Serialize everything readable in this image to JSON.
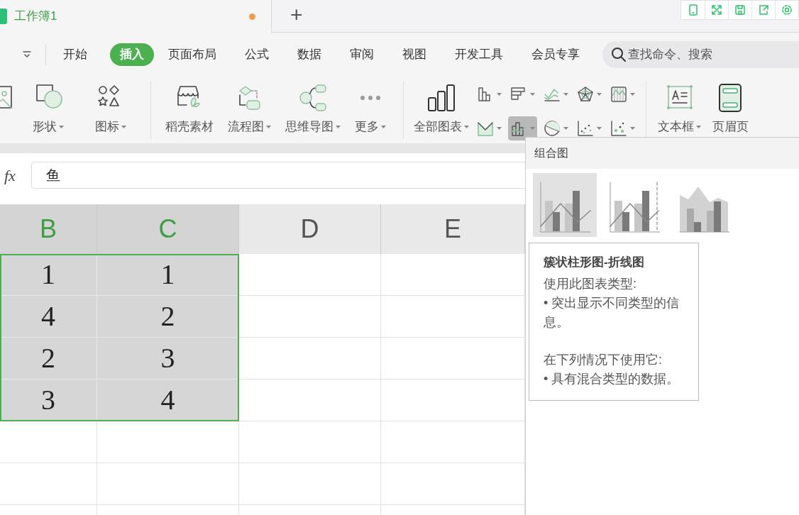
{
  "title_bar": {
    "tab": {
      "title": "工作簿1",
      "modified": true
    },
    "new_tab": "+"
  },
  "ribbon_tabs": [
    {
      "label": "开始",
      "selected": false
    },
    {
      "label": "插入",
      "selected": true
    },
    {
      "label": "页面布局",
      "selected": false
    },
    {
      "label": "公式",
      "selected": false
    },
    {
      "label": "数据",
      "selected": false
    },
    {
      "label": "审阅",
      "selected": false
    },
    {
      "label": "视图",
      "selected": false
    },
    {
      "label": "开发工具",
      "selected": false
    },
    {
      "label": "会员专享",
      "selected": false
    }
  ],
  "search": {
    "placeholder": "查找命令、搜索"
  },
  "toolbar": {
    "left_tools": [
      {
        "kind": "shape",
        "label": "形状"
      },
      {
        "kind": "icons",
        "label": "图标"
      }
    ],
    "middle_tools": [
      {
        "kind": "docer",
        "label": "稻壳素材",
        "dropdown": false
      },
      {
        "kind": "flow",
        "label": "流程图",
        "dropdown": true
      },
      {
        "kind": "mind",
        "label": "思维导图",
        "dropdown": true
      },
      {
        "kind": "more",
        "label": "更多",
        "dropdown": true
      }
    ],
    "all_charts": "全部图表",
    "chart_buttons": [
      {
        "kind": "column",
        "selected": false
      },
      {
        "kind": "bar",
        "selected": false
      },
      {
        "kind": "line",
        "selected": false
      },
      {
        "kind": "radar",
        "selected": false
      },
      {
        "kind": "stock",
        "selected": false
      },
      {
        "kind": "area",
        "selected": false
      },
      {
        "kind": "combo",
        "selected": true
      },
      {
        "kind": "pie",
        "selected": false
      },
      {
        "kind": "scatter",
        "selected": false
      },
      {
        "kind": "bubble",
        "selected": false
      }
    ],
    "right_tools": [
      {
        "kind": "textbox",
        "label": "文本框"
      },
      {
        "kind": "header",
        "label": "页眉页"
      }
    ]
  },
  "formula_bar": {
    "label": "fx",
    "value": "鱼"
  },
  "grid": {
    "columns": [
      {
        "label": "B",
        "selected": true
      },
      {
        "label": "C",
        "selected": true
      },
      {
        "label": "D",
        "selected": false
      },
      {
        "label": "E",
        "selected": false
      }
    ],
    "rows": [
      {
        "cells": [
          "1",
          "1"
        ],
        "selected": true
      },
      {
        "cells": [
          "4",
          "2"
        ],
        "selected": true
      },
      {
        "cells": [
          "2",
          "3"
        ],
        "selected": true
      },
      {
        "cells": [
          "3",
          "4"
        ],
        "selected": true
      }
    ]
  },
  "combo_menu": {
    "title": "组合图",
    "types": [
      {
        "kind": "column-line",
        "selected": true
      },
      {
        "kind": "column-line-axis",
        "selected": false
      },
      {
        "kind": "area-column",
        "selected": false
      }
    ],
    "tooltip": {
      "title": "簇状柱形图-折线图",
      "paragraphs": [
        [
          "使用此图表类型:",
          "• 突出显示不同类型的信息。"
        ],
        [
          "在下列情况下使用它:",
          "• 具有混合类型的数据。"
        ]
      ]
    }
  }
}
